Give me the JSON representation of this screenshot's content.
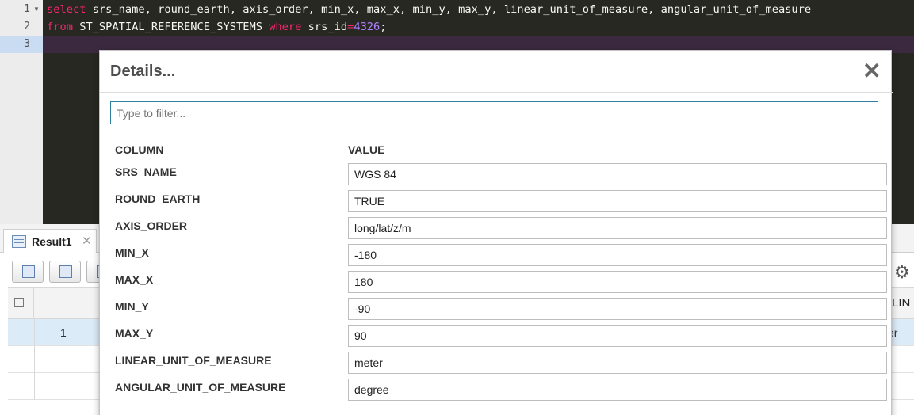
{
  "editor": {
    "lines": [
      {
        "number": "1",
        "folded": true,
        "tokens": [
          {
            "t": "select",
            "k": "kw"
          },
          {
            "t": " srs_name, round_earth, axis_order, min_x, max_x, min_y, max_y, linear_unit_of_measure, angular_unit_of_measure",
            "k": ""
          }
        ]
      },
      {
        "number": "2",
        "folded": false,
        "tokens": [
          {
            "t": "from",
            "k": "kw"
          },
          {
            "t": " ST_SPATIAL_REFERENCE_SYSTEMS ",
            "k": ""
          },
          {
            "t": "where",
            "k": "kw"
          },
          {
            "t": " srs_id",
            "k": ""
          },
          {
            "t": "=",
            "k": "kw"
          },
          {
            "t": "4326",
            "k": "num"
          },
          {
            "t": ";",
            "k": ""
          }
        ]
      },
      {
        "number": "3",
        "folded": false,
        "tokens": []
      }
    ],
    "colors": {
      "background": "#272822",
      "keyword": "#f92672",
      "number": "#ae81ff",
      "text": "#f8f8f2"
    }
  },
  "result": {
    "tab_label": "Result1",
    "tab_close": "✕",
    "toolbar_buttons": [
      "copy-icon",
      "table-icon",
      "export-icon"
    ],
    "settings_icon": "gear-icon",
    "partial_column_header": "LIN",
    "rows": [
      {
        "number": "1",
        "partial_value": "er",
        "selected": true
      },
      {
        "number": "",
        "partial_value": "",
        "selected": false
      },
      {
        "number": "",
        "partial_value": "",
        "selected": false
      }
    ]
  },
  "dialog": {
    "title": "Details...",
    "close_glyph": "✕",
    "filter_placeholder": "Type to filter...",
    "column_header": "COLUMN",
    "value_header": "VALUE",
    "properties": [
      {
        "name": "SRS_NAME",
        "value": "WGS 84"
      },
      {
        "name": "ROUND_EARTH",
        "value": "TRUE"
      },
      {
        "name": "AXIS_ORDER",
        "value": "long/lat/z/m"
      },
      {
        "name": "MIN_X",
        "value": "-180"
      },
      {
        "name": "MAX_X",
        "value": "180"
      },
      {
        "name": "MIN_Y",
        "value": "-90"
      },
      {
        "name": "MAX_Y",
        "value": "90"
      },
      {
        "name": "LINEAR_UNIT_OF_MEASURE",
        "value": "meter"
      },
      {
        "name": "ANGULAR_UNIT_OF_MEASURE",
        "value": "degree"
      }
    ],
    "accent": "#2f7fa2"
  }
}
